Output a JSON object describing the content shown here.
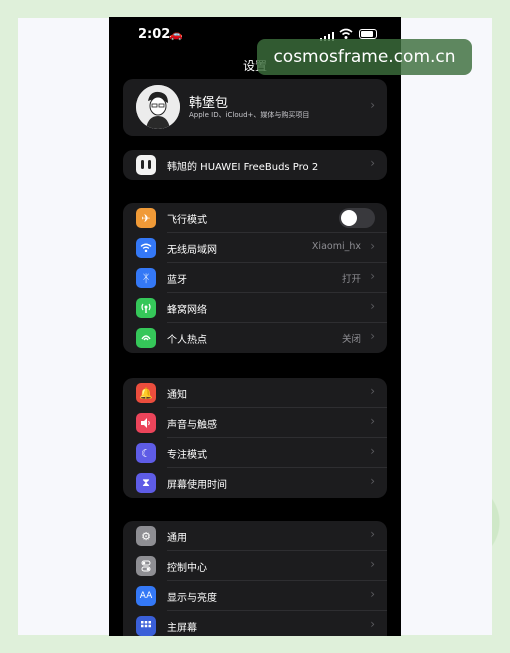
{
  "status_bar": {
    "time": "2:02"
  },
  "header": {
    "title": "设置"
  },
  "profile": {
    "name": "韩堡包",
    "subtitle": "Apple ID、iCloud+、媒体与购买项目"
  },
  "device": {
    "label": "韩旭的 HUAWEI FreeBuds Pro 2"
  },
  "connectivity": [
    {
      "label": "飞行模式",
      "value": "",
      "icon": "airplane-icon",
      "color": "#f09a37",
      "toggle": true
    },
    {
      "label": "无线局域网",
      "value": "Xiaomi_hx",
      "icon": "wifi-icon",
      "color": "#3478f6"
    },
    {
      "label": "蓝牙",
      "value": "打开",
      "icon": "bluetooth-icon",
      "color": "#3478f6"
    },
    {
      "label": "蜂窝网络",
      "value": "",
      "icon": "cellular-icon",
      "color": "#35c759"
    },
    {
      "label": "个人热点",
      "value": "关闭",
      "icon": "hotspot-icon",
      "color": "#35c759"
    }
  ],
  "notifications": [
    {
      "label": "通知",
      "icon": "notification-icon",
      "color": "#eb4d3d"
    },
    {
      "label": "声音与触感",
      "icon": "sound-icon",
      "color": "#eb445a"
    },
    {
      "label": "专注模式",
      "icon": "moon-icon",
      "color": "#5e5ce6"
    },
    {
      "label": "屏幕使用时间",
      "icon": "hourglass-icon",
      "color": "#5e5ce6"
    }
  ],
  "general": [
    {
      "label": "通用",
      "icon": "gear-icon",
      "color": "#8e8e93"
    },
    {
      "label": "控制中心",
      "icon": "control-center-icon",
      "color": "#8e8e93"
    },
    {
      "label": "显示与亮度",
      "icon": "display-icon",
      "color": "#3478f6"
    },
    {
      "label": "主屏幕",
      "icon": "home-screen-icon",
      "color": "#3a5fd8"
    }
  ],
  "watermark": "cosmosframe.com.cn"
}
